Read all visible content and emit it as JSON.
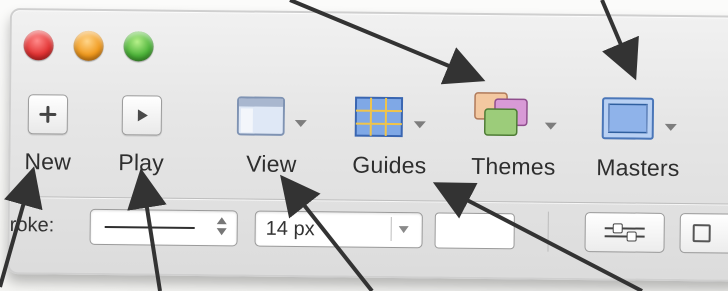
{
  "toolbar": {
    "items": [
      {
        "label": "New",
        "icon": "plus-icon",
        "has_dropdown": false
      },
      {
        "label": "Play",
        "icon": "play-icon",
        "has_dropdown": false
      },
      {
        "label": "View",
        "icon": "view-window-icon",
        "has_dropdown": true
      },
      {
        "label": "Guides",
        "icon": "grid-icon",
        "has_dropdown": true
      },
      {
        "label": "Themes",
        "icon": "themes-icon",
        "has_dropdown": true
      },
      {
        "label": "Masters",
        "icon": "masters-icon",
        "has_dropdown": true
      }
    ]
  },
  "format_bar": {
    "stroke_label": "Stroke:",
    "stroke_visible_label": "roke:",
    "font_size_value": "14 px"
  },
  "colors": {
    "accent_grid": "#4a82d8",
    "close": "#e23434",
    "minimize": "#f09a1e",
    "zoom": "#4db43a"
  }
}
